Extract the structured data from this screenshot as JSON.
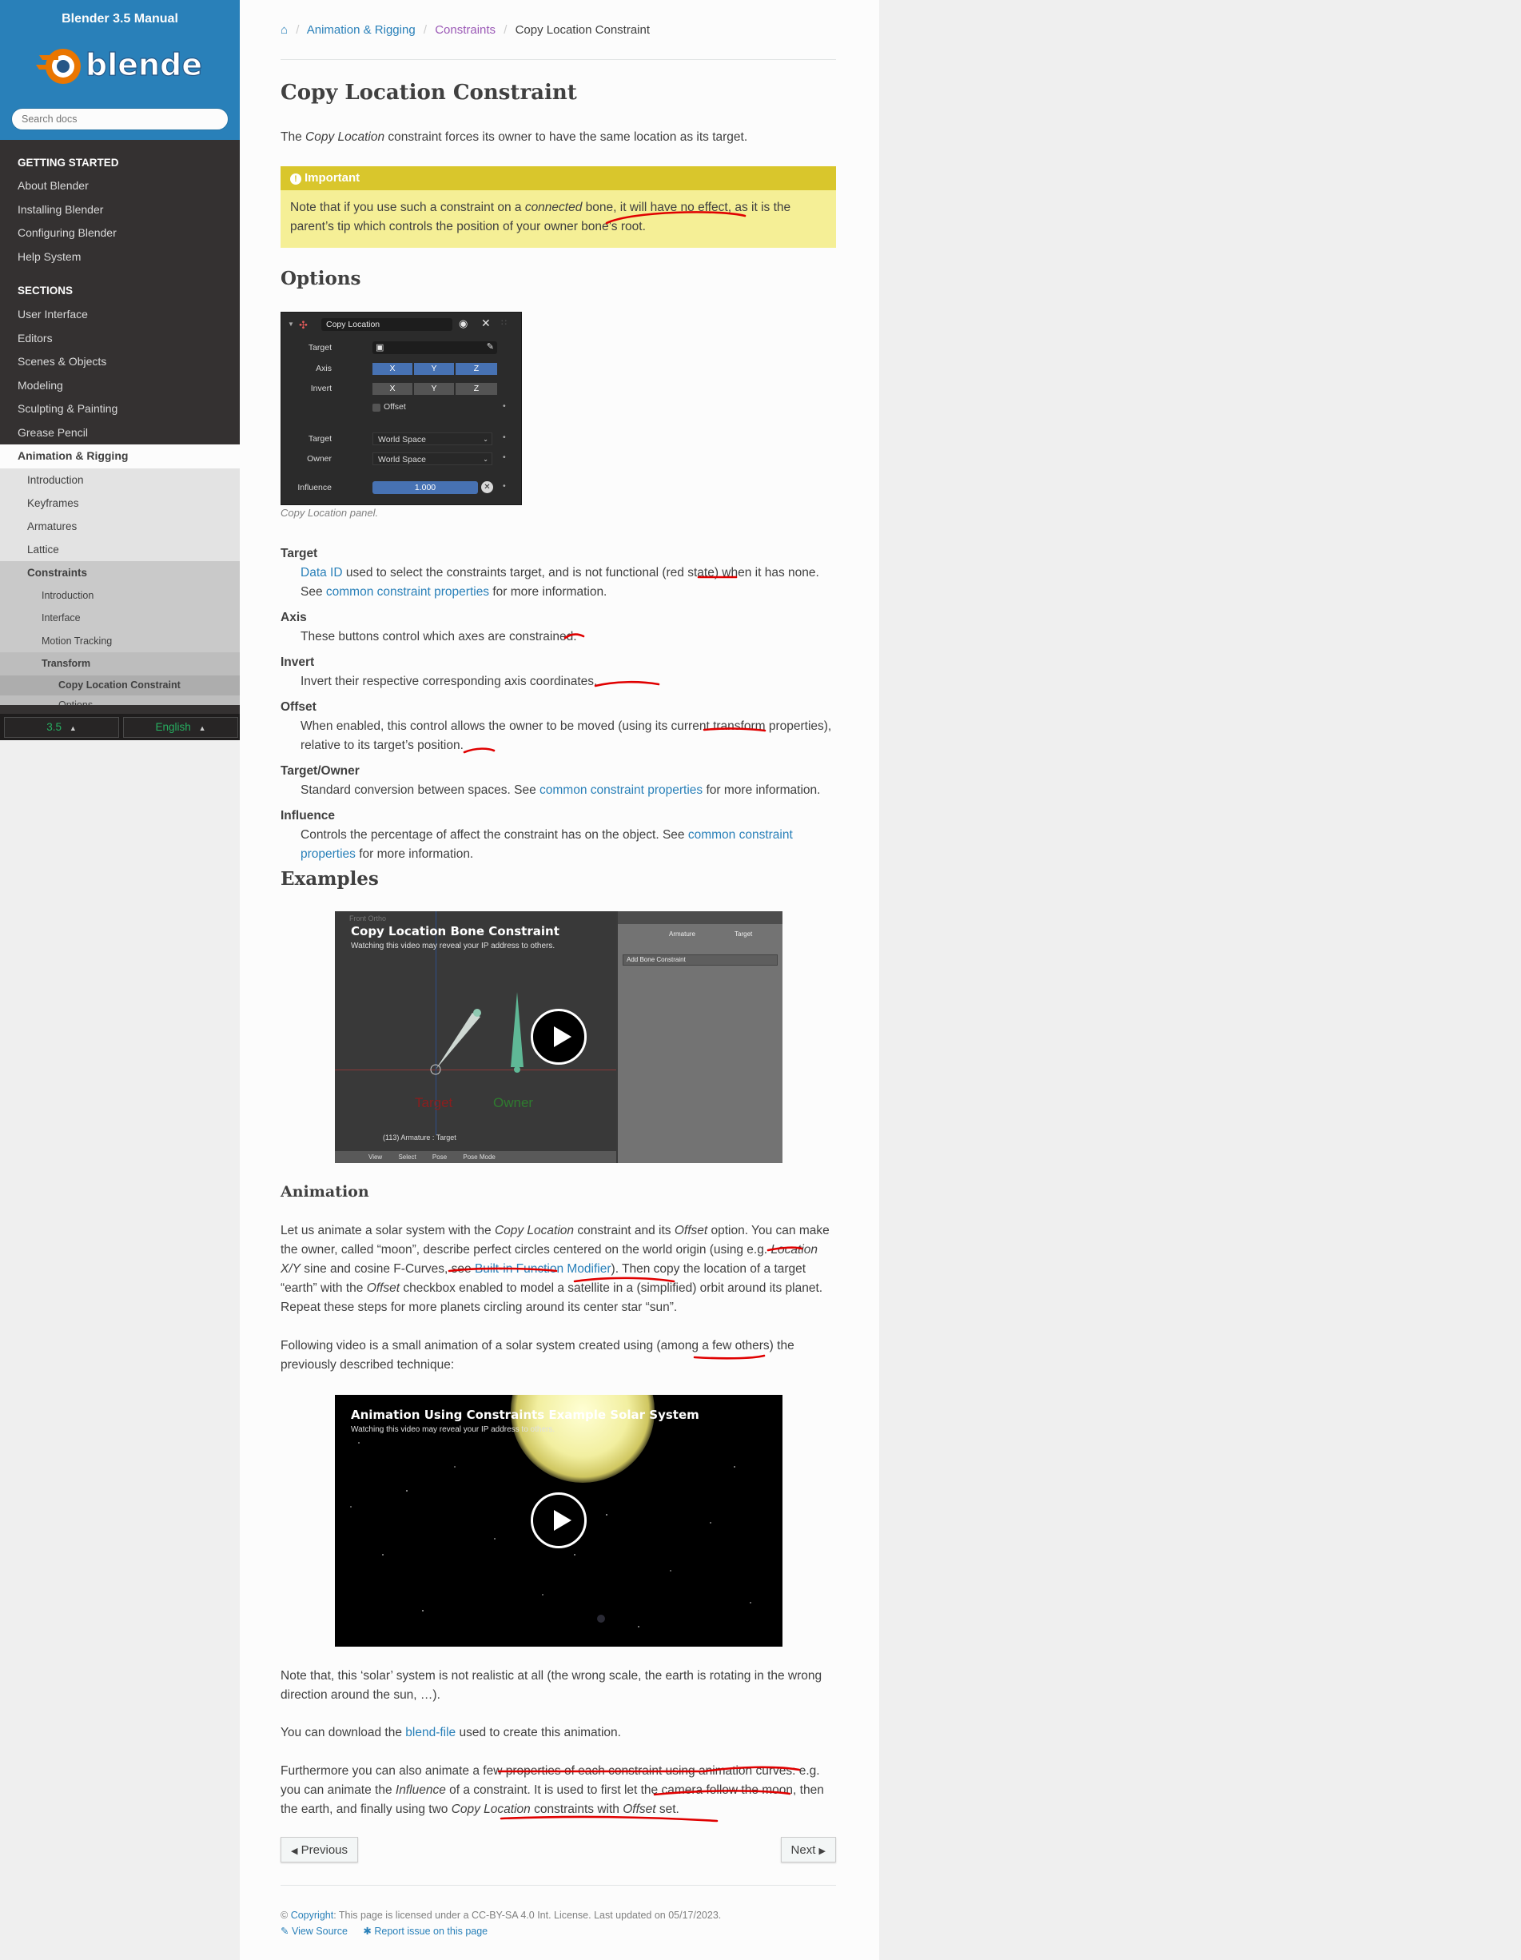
{
  "sidebar": {
    "manual_title": "Blender 3.5 Manual",
    "logo_text": "blender",
    "search_placeholder": "Search docs",
    "getting_started_caption": "GETTING STARTED",
    "getting_started": [
      "About Blender",
      "Installing Blender",
      "Configuring Blender",
      "Help System"
    ],
    "sections_caption": "SECTIONS",
    "sections": [
      "User Interface",
      "Editors",
      "Scenes & Objects",
      "Modeling",
      "Sculpting & Painting",
      "Grease Pencil"
    ],
    "current_section": "Animation & Rigging",
    "anim_items": [
      "Introduction",
      "Keyframes",
      "Armatures",
      "Lattice"
    ],
    "current_sub": "Constraints",
    "constraint_items": [
      "Introduction",
      "Interface",
      "Motion Tracking"
    ],
    "current_l3": "Transform",
    "current_l4": "Copy Location Constraint",
    "clipped_l5": "Options",
    "version_label": "3.5",
    "language_label": "English",
    "dropdown_arrow": "▲"
  },
  "breadcrumb": {
    "home_icon": "home-icon",
    "home_glyph": "⌂",
    "separator": "/",
    "level1": "Animation & Rigging",
    "level2": "Constraints",
    "current": "Copy Location Constraint"
  },
  "page": {
    "title": "Copy Location Constraint",
    "intro_pre": "The ",
    "intro_em": "Copy Location",
    "intro_post": " constraint forces its owner to have the same location as its target.",
    "admonition": {
      "title": "Important",
      "icon": "info-circle-icon",
      "icon_glyph": "!",
      "text_pre": "Note that if you use such a constraint on a ",
      "text_em": "connected",
      "text_post": " bone, it will have no effect, as it is the parent’s tip which controls the position of your owner bone’s root."
    },
    "options_heading": "Options",
    "panel": {
      "name_field": "Copy Location",
      "target_label": "Target",
      "axis_label": "Axis",
      "invert_label": "Invert",
      "axes": [
        "X",
        "Y",
        "Z"
      ],
      "offset_label": "Offset",
      "target_space_label": "Target",
      "owner_space_label": "Owner",
      "target_space": "World Space",
      "owner_space": "World Space",
      "influence_label": "Influence",
      "influence_value": "1.000"
    },
    "panel_caption": "Copy Location panel.",
    "options": [
      {
        "term": "Target",
        "pre": "",
        "link": "Data ID",
        "mid": " used to select the constraints target, and is not functional (red state) when it has none. See ",
        "link2": "common constraint properties",
        "post": " for more information."
      },
      {
        "term": "Axis",
        "text": "These buttons control which axes are constrained."
      },
      {
        "term": "Invert",
        "text": "Invert their respective corresponding axis coordinates."
      },
      {
        "term": "Offset",
        "text": "When enabled, this control allows the owner to be moved (using its current transform properties), relative to its target’s position."
      },
      {
        "term": "Target/Owner",
        "pre": "Standard conversion between spaces. See ",
        "link": "common constraint properties",
        "post": " for more information."
      },
      {
        "term": "Influence",
        "pre": "Controls the percentage of affect the constraint has on the object. See ",
        "link": "common constraint properties",
        "post": " for more information."
      }
    ],
    "examples_heading": "Examples",
    "video1": {
      "title": "Copy Location Bone Constraint",
      "note": "Watching this video may reveal your IP address to others.",
      "viewport_label": "Front Ortho",
      "target_label": "Target",
      "owner_label": "Owner",
      "status": "(113) Armature : Target",
      "side_button": "Add Bone Constraint",
      "side_tab1": "Armature",
      "side_tab2": "Target",
      "menu": [
        "View",
        "Select",
        "Pose",
        "Pose Mode"
      ]
    },
    "animation_heading": "Animation",
    "anim_p1": {
      "a": "Let us animate a solar system with the ",
      "b": "Copy Location",
      "c": " constraint and its ",
      "d": "Offset",
      "e": " option. You can make the owner, called “moon”, describe perfect circles centered on the world origin (using e.g. ",
      "f": "Location X/Y",
      "g": " sine and cosine F-Curves, see ",
      "link": "Built-in Function Modifier",
      "h": "). Then copy the location of a target “earth” with the ",
      "i": "Offset",
      "j": " checkbox enabled to model a satellite in a (simplified) orbit around its planet. Repeat these steps for more planets circling around its center star “sun”."
    },
    "anim_p2": "Following video is a small animation of a solar system created using (among a few others) the previously described technique:",
    "video2": {
      "title": "Animation Using Constraints Example Solar System",
      "note": "Watching this video may reveal your IP address to others."
    },
    "anim_p3": "Note that, this ‘solar’ system is not realistic at all (the wrong scale, the earth is rotating in the wrong direction around the sun, …).",
    "anim_p4_pre": "You can download the ",
    "anim_p4_link": "blend-file",
    "anim_p4_post": " used to create this animation.",
    "anim_p5": {
      "a": "Furthermore you can also animate a few properties of each constraint using animation curves: e.g. you can animate the ",
      "b": "Influence",
      "c": " of a constraint. It is used to first let the camera follow the moon, then the earth, and finally using two ",
      "d": "Copy Location",
      "e": " constraints with ",
      "f": "Offset",
      "g": " set."
    },
    "prev_label": "Previous",
    "next_label": "Next",
    "prev_icon": "arrow-circle-left-icon",
    "next_icon": "arrow-circle-right-icon",
    "prev_glyph": "◀",
    "next_glyph": "▶"
  },
  "footer": {
    "copyright_symbol": "©",
    "copyright_link": "Copyright",
    "license": ": This page is licensed under a CC-BY-SA 4.0 Int. License. Last updated on 05/17/2023.",
    "view_source": "View Source",
    "report_issue": "Report issue on this page",
    "view_source_icon": "edit-icon",
    "report_issue_icon": "bug-icon",
    "view_source_glyph": "✎",
    "report_issue_glyph": "✱"
  },
  "colors": {
    "sidebar_top": "#2980b9",
    "sidebar_bg": "#343131",
    "link": "#2980b9",
    "admonition_title": "#d9c62c",
    "admonition_bg": "#f5ef96",
    "annotation_red": "#e00000"
  }
}
